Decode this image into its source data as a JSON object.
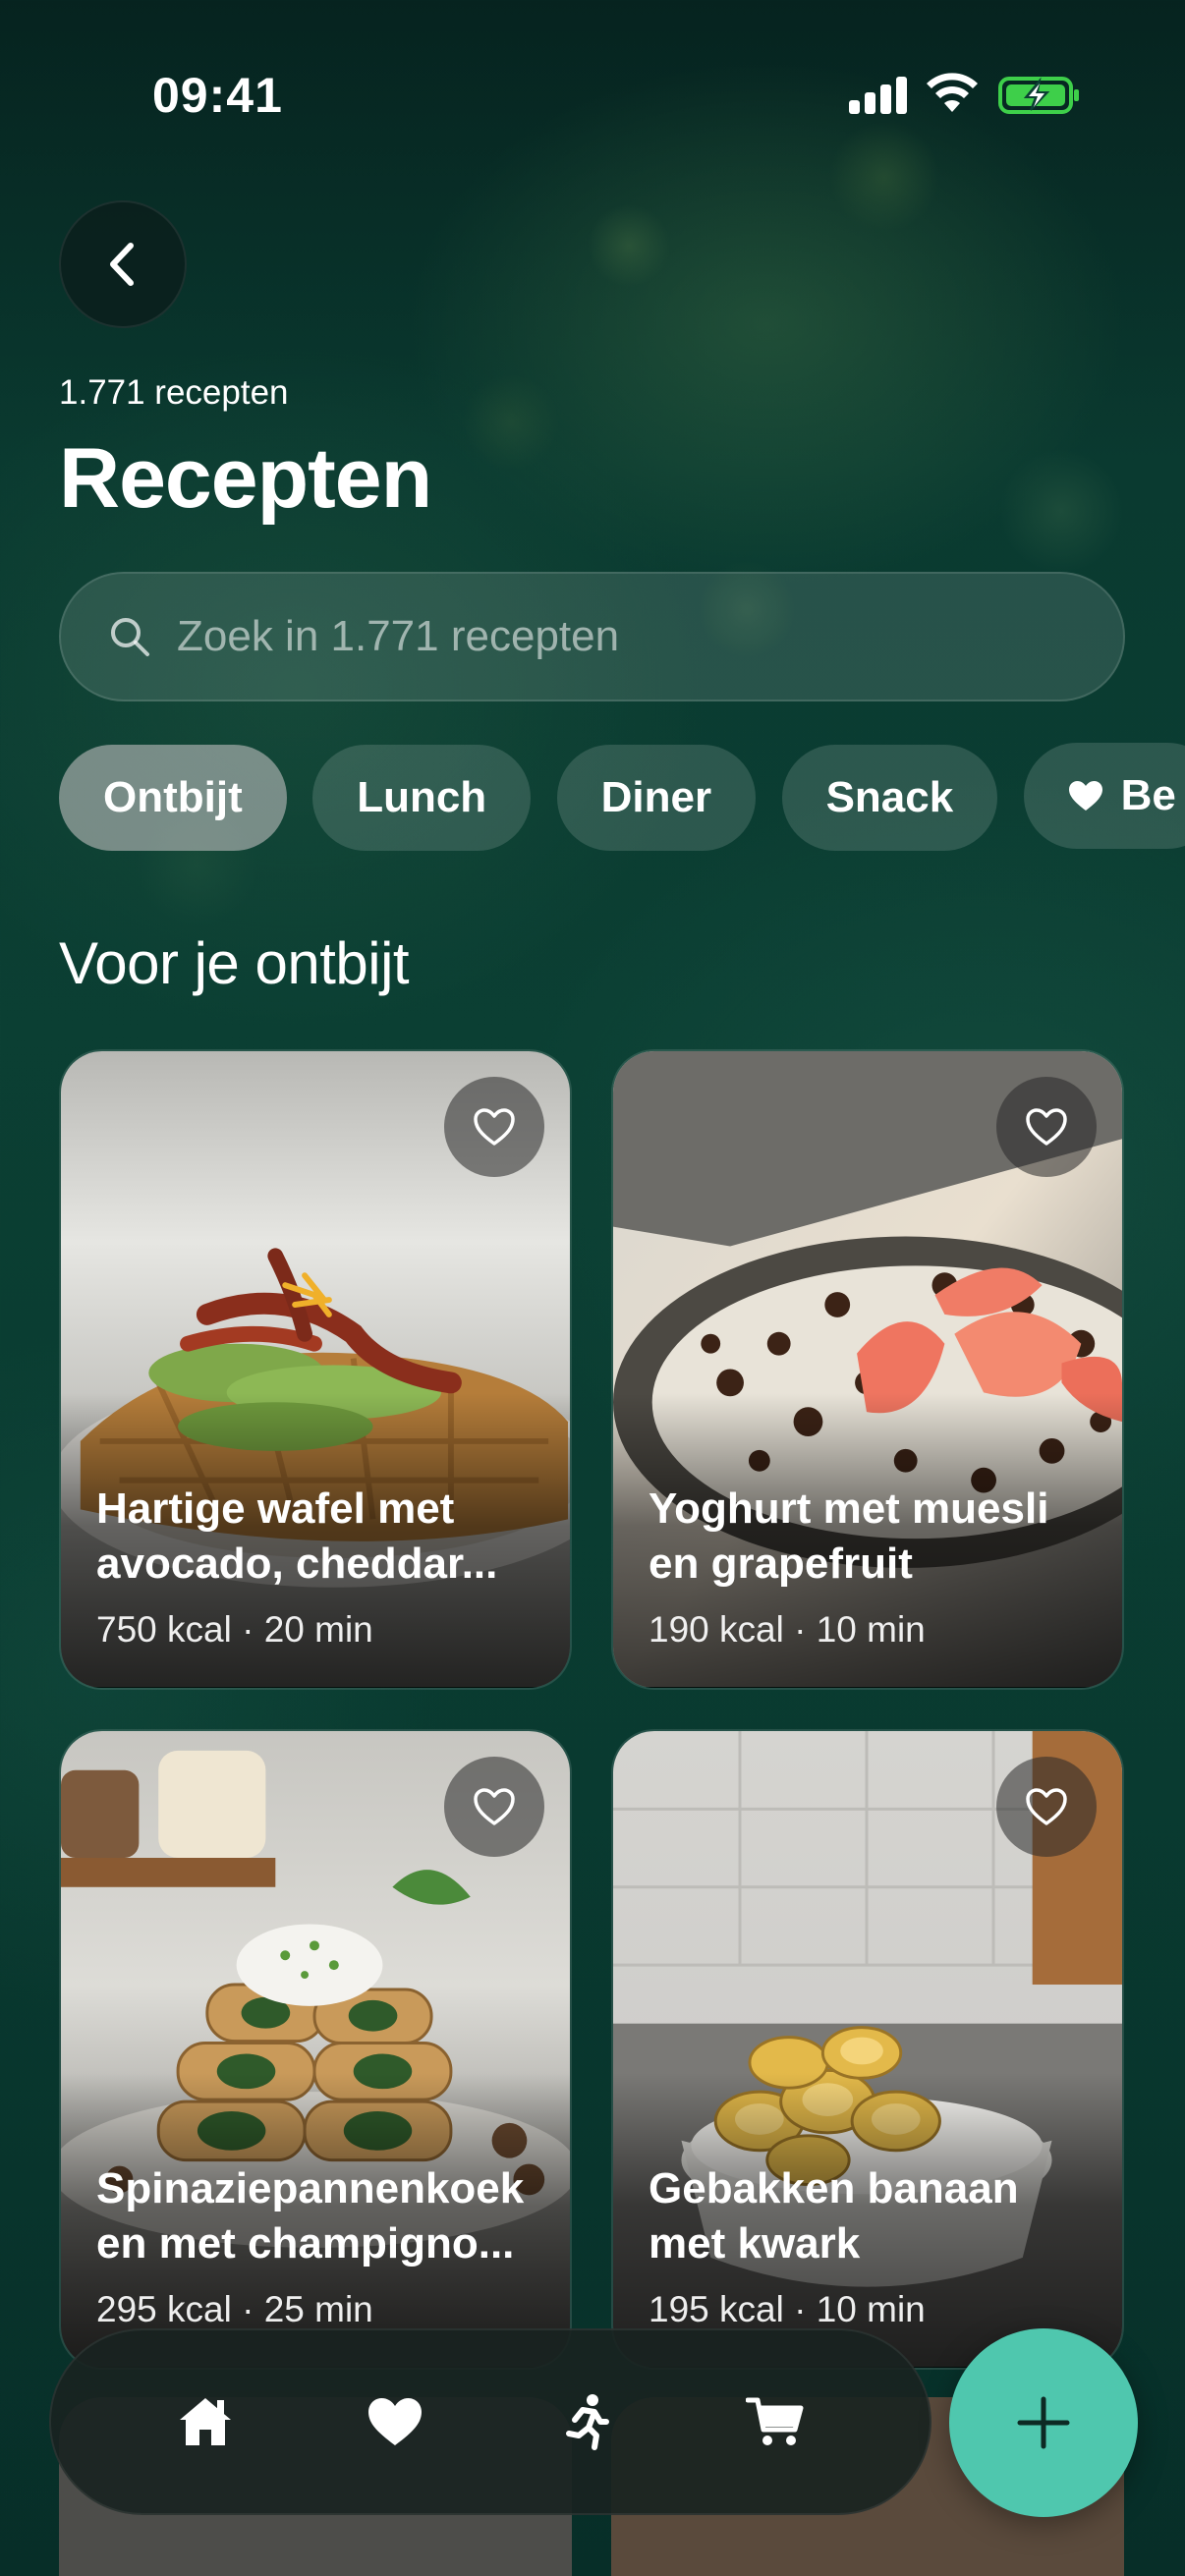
{
  "status_bar": {
    "time": "09:41"
  },
  "header": {
    "count_label": "1.771 recepten",
    "title": "Recepten"
  },
  "search": {
    "placeholder": "Zoek in 1.771 recepten"
  },
  "chips": [
    {
      "label": "Ontbijt",
      "active": true
    },
    {
      "label": "Lunch"
    },
    {
      "label": "Diner"
    },
    {
      "label": "Snack"
    },
    {
      "label": "Be",
      "icon": "heart-icon"
    }
  ],
  "section_title": "Voor je ontbijt",
  "recipes": [
    {
      "name": "Hartige wafel met avocado, cheddar...",
      "meta": "750 kcal · 20 min"
    },
    {
      "name": "Yoghurt met muesli en grapefruit",
      "meta": "190 kcal · 10 min"
    },
    {
      "name": "Spinaziepannenkoek en met champigno...",
      "meta": "295 kcal · 25 min"
    },
    {
      "name": "Gebakken banaan met kwark",
      "meta": "195 kcal · 10 min"
    }
  ],
  "tabbar": {
    "items": [
      {
        "icon": "home-icon"
      },
      {
        "icon": "heart-icon"
      },
      {
        "icon": "running-icon"
      },
      {
        "icon": "cart-icon"
      }
    ]
  },
  "fab": {
    "icon": "plus-icon"
  },
  "colors": {
    "accent": "#4fc7ae",
    "background": "#0b3f33"
  }
}
